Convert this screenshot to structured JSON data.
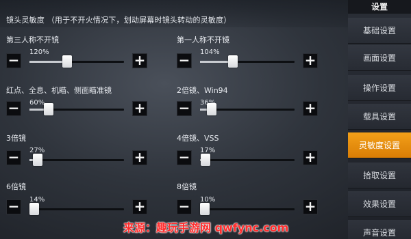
{
  "section_title": "镜头灵敏度 （用于不开火情况下，划动屏幕时镜头转动的灵敏度）",
  "sidebar": {
    "header": "设置",
    "items": [
      {
        "label": "基础设置",
        "active": false
      },
      {
        "label": "画面设置",
        "active": false
      },
      {
        "label": "操作设置",
        "active": false
      },
      {
        "label": "载具设置",
        "active": false
      },
      {
        "label": "灵敏度设置",
        "active": true
      },
      {
        "label": "拾取设置",
        "active": false
      },
      {
        "label": "效果设置",
        "active": false
      },
      {
        "label": "声音设置",
        "active": false
      }
    ]
  },
  "sliders": [
    {
      "label": "第三人称不开镜",
      "percent_text": "120%",
      "level": 0.4
    },
    {
      "label": "第一人称不开镜",
      "percent_text": "104%",
      "level": 0.35
    },
    {
      "label": "红点、全息、机瞄、侧面瞄准镜",
      "percent_text": "60%",
      "level": 0.2
    },
    {
      "label": "2倍镜、Win94",
      "percent_text": "36%",
      "level": 0.12
    },
    {
      "label": "3倍镜",
      "percent_text": "27%",
      "level": 0.09
    },
    {
      "label": "4倍镜、VSS",
      "percent_text": "17%",
      "level": 0.06
    },
    {
      "label": "6倍镜",
      "percent_text": "14%",
      "level": 0.05
    },
    {
      "label": "8倍镜",
      "percent_text": "10%",
      "level": 0.03
    }
  ],
  "controls": {
    "minus": "−",
    "plus": "+"
  },
  "watermark": "来源：趣玩手游网 qwfync.com"
}
